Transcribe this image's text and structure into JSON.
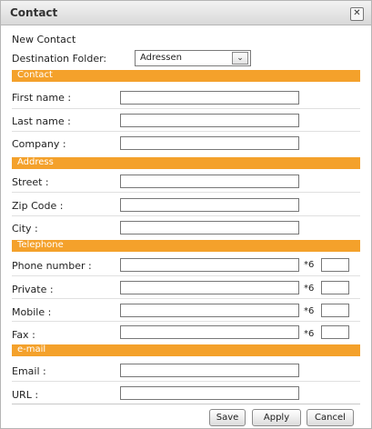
{
  "window": {
    "title": "Contact",
    "close_label": "✕"
  },
  "new_contact_label": "New Contact",
  "destination": {
    "label": "Destination Folder:",
    "selected": "Adressen",
    "arrow": "⌄"
  },
  "sections": {
    "contact": "Contact",
    "address": "Address",
    "telephone": "Telephone",
    "email": "e-mail"
  },
  "fields": {
    "first_name": "First name :",
    "last_name": "Last name :",
    "company": "Company :",
    "street": "Street :",
    "zip": "Zip Code :",
    "city": "City :",
    "phone": "Phone number :",
    "private": "Private :",
    "mobile": "Mobile :",
    "fax": "Fax :",
    "email": "Email :",
    "url": "URL :"
  },
  "phone_suffix": "*6",
  "buttons": {
    "save": "Save",
    "apply": "Apply",
    "cancel": "Cancel"
  }
}
